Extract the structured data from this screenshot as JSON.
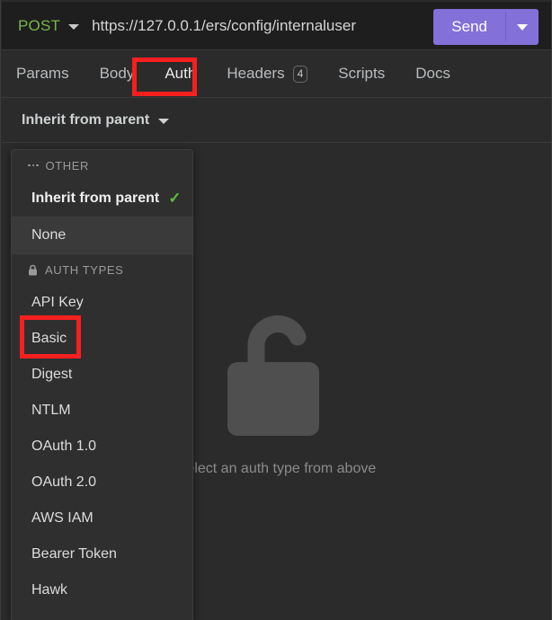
{
  "request": {
    "method": "POST",
    "method_caret_icon": "chevron-down-icon",
    "url": "https://127.0.0.1/ers/config/internaluser",
    "send_label": "Send",
    "send_caret_icon": "chevron-down-icon"
  },
  "tabs": [
    {
      "label": "Params",
      "active": false
    },
    {
      "label": "Body",
      "active": false
    },
    {
      "label": "Auth",
      "active": true
    },
    {
      "label": "Headers",
      "active": false,
      "badge": "4"
    },
    {
      "label": "Scripts",
      "active": false
    },
    {
      "label": "Docs",
      "active": false
    }
  ],
  "auth_selector": {
    "selected_label": "Inherit from parent",
    "caret_icon": "chevron-down-icon"
  },
  "empty_state": {
    "icon": "unlocked-padlock-icon",
    "text": "Select an auth type from above"
  },
  "dropdown": {
    "sections": [
      {
        "header": "OTHER",
        "header_icon": "dots-icon",
        "items": [
          {
            "label": "Inherit from parent",
            "selected": true,
            "check_icon": "check-icon",
            "hover": false
          },
          {
            "label": "None",
            "selected": false,
            "hover": true
          }
        ]
      },
      {
        "header": "AUTH TYPES",
        "header_icon": "lock-icon",
        "items": [
          {
            "label": "API Key",
            "selected": false,
            "hover": false
          },
          {
            "label": "Basic",
            "selected": false,
            "hover": false
          },
          {
            "label": "Digest",
            "selected": false,
            "hover": false
          },
          {
            "label": "NTLM",
            "selected": false,
            "hover": false
          },
          {
            "label": "OAuth 1.0",
            "selected": false,
            "hover": false
          },
          {
            "label": "OAuth 2.0",
            "selected": false,
            "hover": false
          },
          {
            "label": "AWS IAM",
            "selected": false,
            "hover": false
          },
          {
            "label": "Bearer Token",
            "selected": false,
            "hover": false
          },
          {
            "label": "Hawk",
            "selected": false,
            "hover": false
          }
        ]
      }
    ]
  },
  "annotations": [
    {
      "name": "auth-tab-highlight",
      "color": "#f71f1f"
    },
    {
      "name": "basic-auth-item-highlight",
      "color": "#f71f1f"
    }
  ],
  "colors": {
    "accent_send": "#8370d8",
    "method_post": "#76b84a",
    "check_green": "#5dbe3f",
    "annotation_red": "#f71f1f",
    "bg_app": "#2b2b2b",
    "bg_urlbar": "#1e1e1e",
    "bg_menu": "#2f2f2f"
  }
}
